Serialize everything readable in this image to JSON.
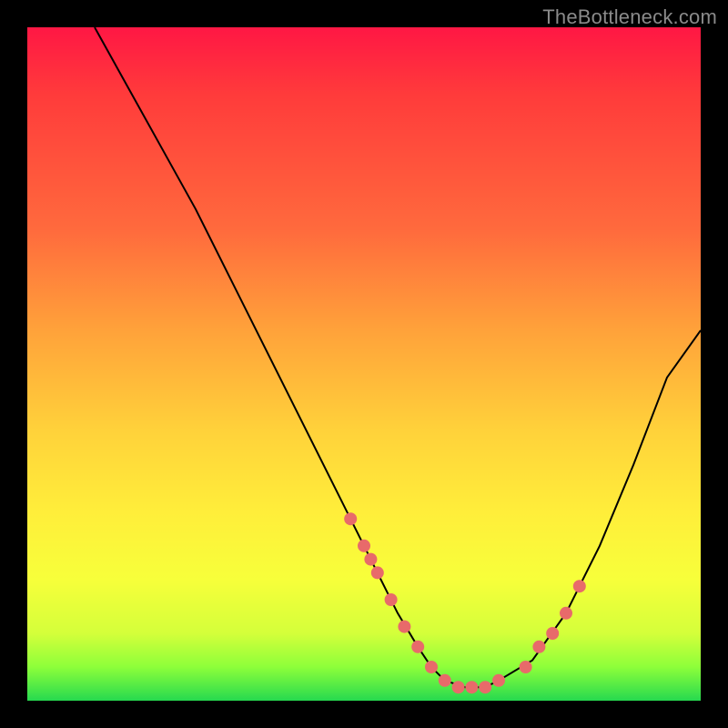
{
  "watermark": "TheBottleneck.com",
  "chart_data": {
    "type": "line",
    "title": "",
    "xlabel": "",
    "ylabel": "",
    "xlim": [
      0,
      100
    ],
    "ylim": [
      0,
      100
    ],
    "grid": false,
    "legend": false,
    "series": [
      {
        "name": "curve",
        "x": [
          10,
          15,
          20,
          25,
          30,
          35,
          40,
          45,
          50,
          52,
          55,
          58,
          60,
          62,
          65,
          68,
          70,
          75,
          80,
          85,
          90,
          95,
          100
        ],
        "y": [
          100,
          91,
          82,
          73,
          63,
          53,
          43,
          33,
          23,
          19,
          13,
          8,
          5,
          3,
          2,
          2,
          3,
          6,
          13,
          23,
          35,
          48,
          55
        ]
      }
    ],
    "markers": {
      "name": "dots",
      "color": "#e86a6a",
      "x": [
        48,
        50,
        51,
        52,
        54,
        56,
        58,
        60,
        62,
        64,
        66,
        68,
        70,
        74,
        76,
        78,
        80,
        82
      ],
      "y": [
        27,
        23,
        21,
        19,
        15,
        11,
        8,
        5,
        3,
        2,
        2,
        2,
        3,
        5,
        8,
        10,
        13,
        17
      ]
    }
  }
}
